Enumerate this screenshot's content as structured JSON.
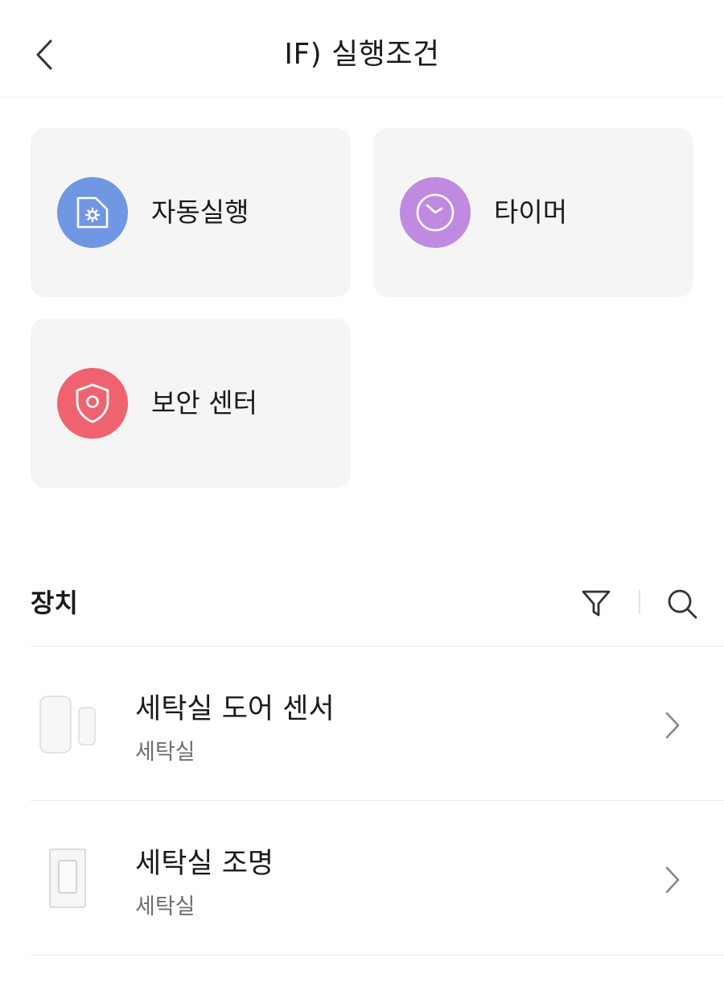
{
  "header": {
    "title": "IF) 실행조건"
  },
  "conditions": [
    {
      "label": "자동실행",
      "icon": "automation-icon",
      "color": "#6f97e4"
    },
    {
      "label": "타이머",
      "icon": "clock-icon",
      "color": "#c08ae0"
    },
    {
      "label": "보안 센터",
      "icon": "shield-icon",
      "color": "#ef6370"
    }
  ],
  "devices_section": {
    "title": "장치"
  },
  "devices": [
    {
      "name": "세탁실 도어 센서",
      "room": "세탁실",
      "icon": "door-sensor-icon"
    },
    {
      "name": "세탁실 조명",
      "room": "세탁실",
      "icon": "light-switch-icon"
    }
  ]
}
